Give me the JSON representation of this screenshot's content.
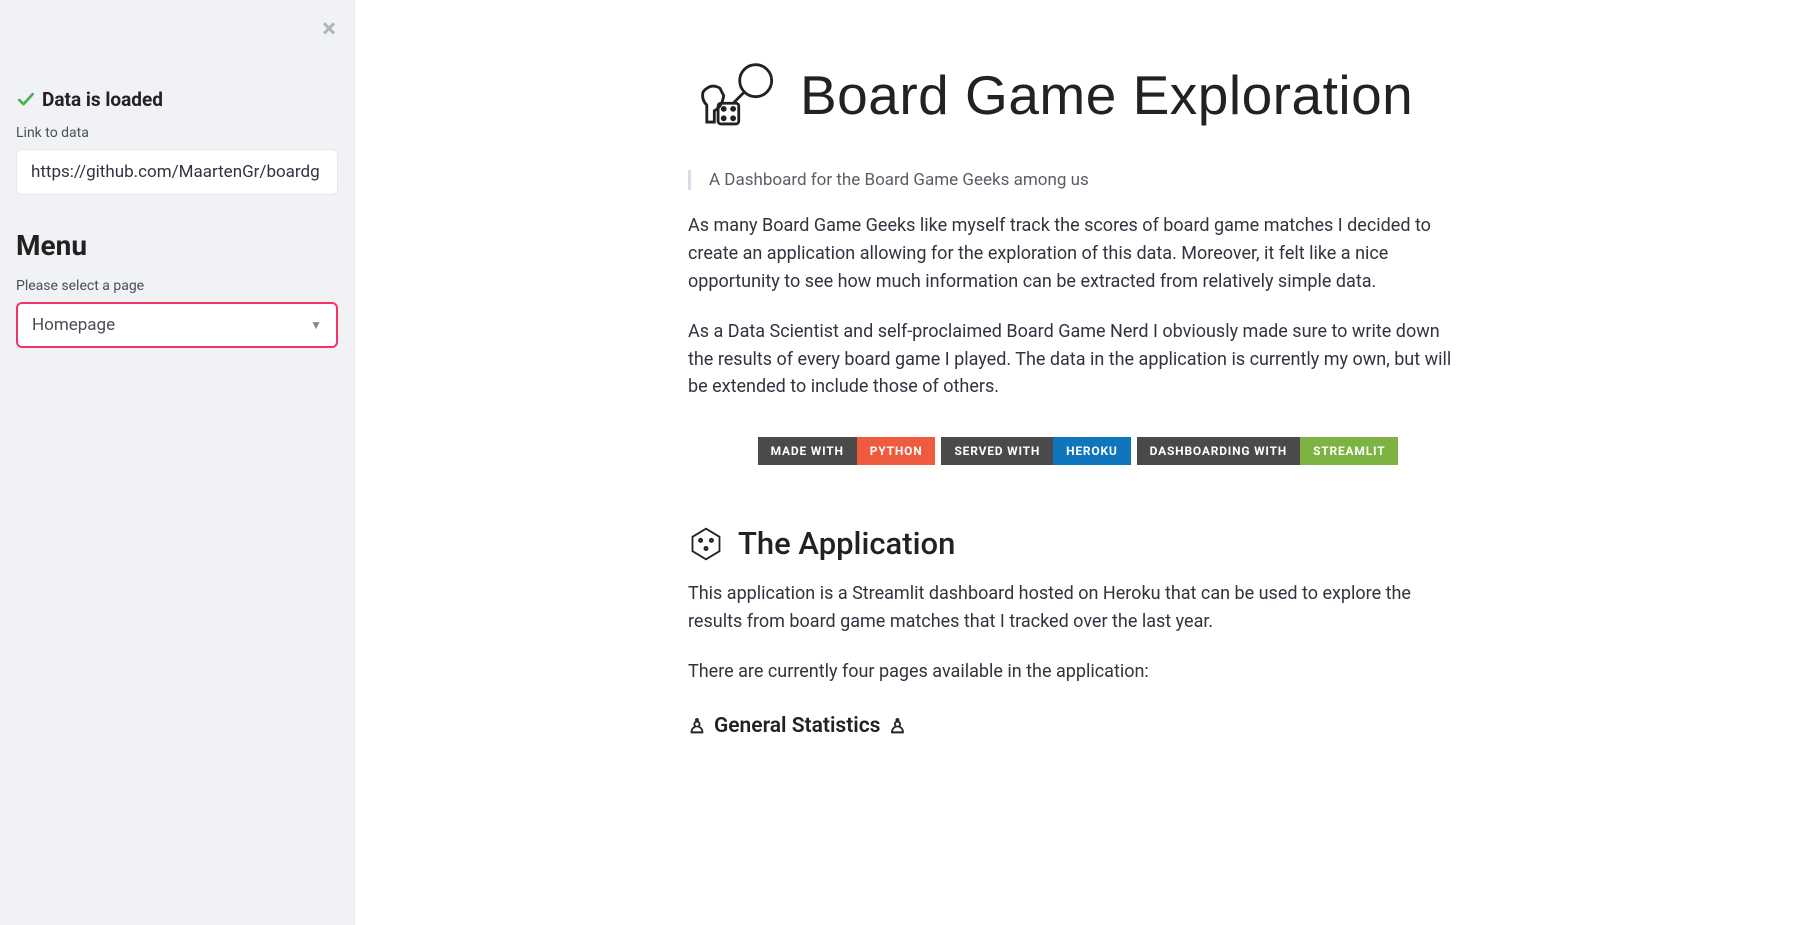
{
  "sidebar": {
    "status_label": "Data is loaded",
    "link_label": "Link to data",
    "link_value": "https://github.com/MaartenGr/boardg",
    "menu_title": "Menu",
    "select_label": "Please select a page",
    "select_value": "Homepage"
  },
  "main": {
    "title": "Board Game Exploration",
    "tagline": "A Dashboard for the Board Game Geeks among us",
    "intro_p1": "As many Board Game Geeks like myself track the scores of board game matches I decided to create an application allowing for the exploration of this data. Moreover, it felt like a nice opportunity to see how much information can be extracted from relatively simple data.",
    "intro_p2": "As a Data Scientist and self-proclaimed Board Game Nerd I obviously made sure to write down the results of every board game I played. The data in the application is currently my own, but will be extended to include those of others.",
    "badges": [
      {
        "left": "MADE WITH",
        "right": "PYTHON",
        "color": "python"
      },
      {
        "left": "SERVED WITH",
        "right": "HEROKU",
        "color": "heroku"
      },
      {
        "left": "DASHBOARDING WITH",
        "right": "STREAMLIT",
        "color": "streamlit"
      }
    ],
    "section_title": "The Application",
    "app_p1": "This application is a Streamlit dashboard hosted on Heroku that can be used to explore the results from board game matches that I tracked over the last year.",
    "app_p2": "There are currently four pages available in the application:",
    "sub_h3": "General Statistics"
  }
}
